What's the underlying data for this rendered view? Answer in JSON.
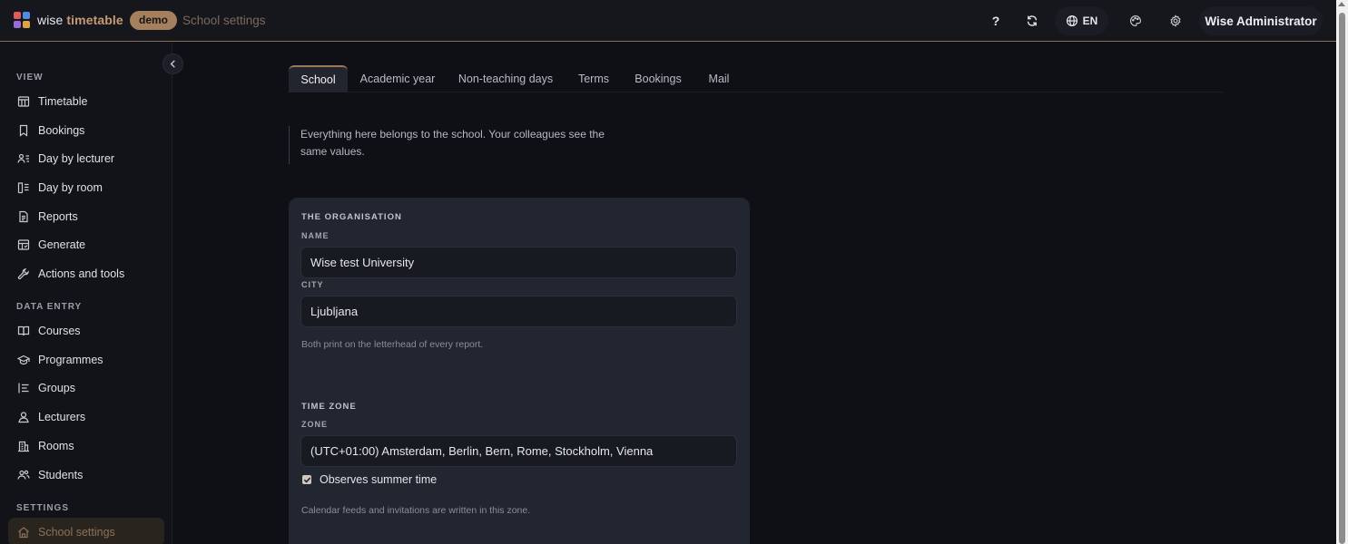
{
  "header": {
    "brand_part1": "wise",
    "brand_part2": "timetable",
    "badge": "demo",
    "breadcrumb": "School settings",
    "help_label": "?",
    "language": "EN",
    "user_name": "Wise Administrator",
    "logo_colors": [
      "#e05a5a",
      "#4d8de8",
      "#9a6ad8",
      "#e3a23c"
    ]
  },
  "sidebar": {
    "view_label": "VIEW",
    "view_items": [
      {
        "label": "Timetable",
        "icon": "table-icon"
      },
      {
        "label": "Bookings",
        "icon": "bookmark-icon"
      },
      {
        "label": "Day by lecturer",
        "icon": "user-list-icon"
      },
      {
        "label": "Day by room",
        "icon": "room-list-icon"
      },
      {
        "label": "Reports",
        "icon": "document-icon"
      },
      {
        "label": "Generate",
        "icon": "grid-icon"
      },
      {
        "label": "Actions and tools",
        "icon": "wrench-icon"
      }
    ],
    "data_label": "DATA ENTRY",
    "data_items": [
      {
        "label": "Courses",
        "icon": "book-icon"
      },
      {
        "label": "Programmes",
        "icon": "graduation-cap-icon"
      },
      {
        "label": "Groups",
        "icon": "groups-icon"
      },
      {
        "label": "Lecturers",
        "icon": "person-icon"
      },
      {
        "label": "Rooms",
        "icon": "building-icon"
      },
      {
        "label": "Students",
        "icon": "people-icon"
      }
    ],
    "settings_label": "SETTINGS",
    "settings_items": [
      {
        "label": "School settings",
        "icon": "home-icon",
        "active": true
      }
    ]
  },
  "tabs": [
    {
      "label": "School",
      "active": true
    },
    {
      "label": "Academic year"
    },
    {
      "label": "Non-teaching days"
    },
    {
      "label": "Terms"
    },
    {
      "label": "Bookings"
    },
    {
      "label": "Mail"
    }
  ],
  "intro": "Everything here belongs to the school. Your colleagues see the same values.",
  "organisation": {
    "heading": "THE ORGANISATION",
    "name_label": "NAME",
    "name_value": "Wise test University",
    "city_label": "CITY",
    "city_value": "Ljubljana",
    "hint": "Both print on the letterhead of every report."
  },
  "timezone": {
    "heading": "TIME ZONE",
    "zone_label": "ZONE",
    "zone_value": "(UTC+01:00) Amsterdam, Berlin, Bern, Rome, Stockholm, Vienna",
    "dst_label": "Observes summer time",
    "dst_checked": true,
    "hint": "Calendar feeds and invitations are written in this zone."
  },
  "colors": {
    "accent": "#a5805f",
    "background": "#0e1016",
    "card": "#222630"
  }
}
